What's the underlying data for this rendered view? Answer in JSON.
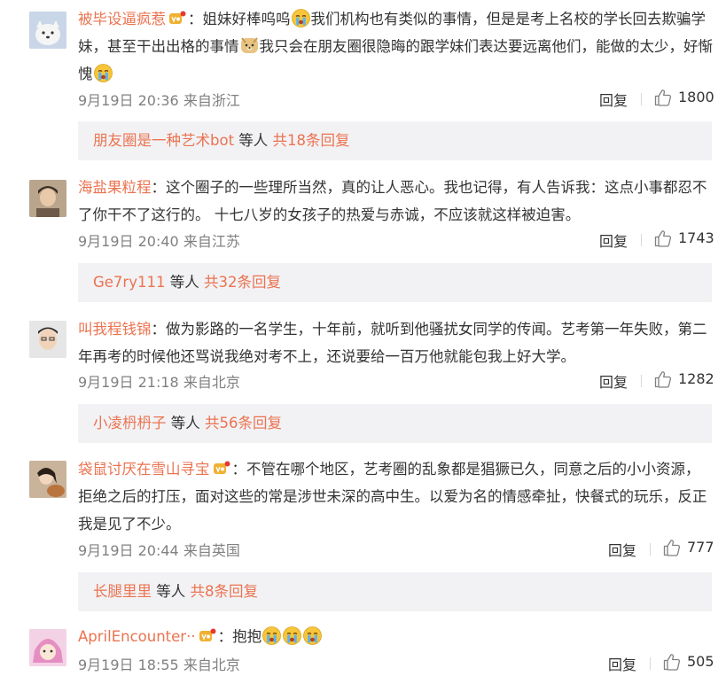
{
  "colors": {
    "accent": "#eb7350",
    "text": "#333333",
    "meta": "#808080",
    "subbox_bg": "#f2f2f5"
  },
  "comments": [
    {
      "user": "被毕设逼疯惹",
      "text_parts": [
        "：姐妹好棒呜呜",
        "我们机构也有类似的事情，但是是考上名校的学长回去欺骗学妹，甚至干出出格的事情",
        "我只会在朋友圈很隐晦的跟学妹们表达要远离他们，能做的太少，好惭愧"
      ],
      "icons": [
        "vip-icon",
        "cry-emoji-icon",
        "doge-emoji-icon",
        "cry-emoji-icon"
      ],
      "time": "9月19日 20:36 来自浙江",
      "reply_label": "回复",
      "likes": "1800",
      "sub_user": "朋友圈是一种艺术bot",
      "sub_mid": " 等人 ",
      "sub_more": "共18条回复"
    },
    {
      "user": "海盐果粒程",
      "text_parts": [
        "：这个圈子的一些理所当然，真的让人恶心。我也记得，有人告诉我：这点小事都忍不了你干不了这行的。 十七八岁的女孩子的热爱与赤诚，不应该就这样被迫害。"
      ],
      "icons": [],
      "time": "9月19日 20:40 来自江苏",
      "reply_label": "回复",
      "likes": "1743",
      "sub_user": "Ge7ry111",
      "sub_mid": " 等人 ",
      "sub_more": "共32条回复"
    },
    {
      "user": "叫我程钱锦",
      "text_parts": [
        "：做为影路的一名学生，十年前，就听到他骚扰女同学的传闻。艺考第一年失败，第二年再考的时候他还骂说我绝对考不上，还说要给一百万他就能包我上好大学。"
      ],
      "icons": [],
      "time": "9月19日 21:18 来自北京",
      "reply_label": "回复",
      "likes": "1282",
      "sub_user": "小凌枬枬子",
      "sub_mid": " 等人 ",
      "sub_more": "共56条回复"
    },
    {
      "user": "袋鼠讨厌在雪山寻宝",
      "text_parts": [
        "：不管在哪个地区，艺考圈的乱象都是猖獗已久，同意之后的小小资源，拒绝之后的打压，面对这些的常是涉世未深的高中生。以爱为名的情感牵扯，快餐式的玩乐，反正我是见了不少。"
      ],
      "icons": [
        "vip-icon"
      ],
      "time": "9月19日 20:44 来自英国",
      "reply_label": "回复",
      "likes": "777",
      "sub_user": "长腿里里",
      "sub_mid": " 等人 ",
      "sub_more": "共8条回复"
    },
    {
      "user": "AprilEncounter··",
      "text_parts": [
        "：抱抱"
      ],
      "icons": [
        "vip-icon",
        "cry-emoji-icon",
        "cry-emoji-icon",
        "cry-emoji-icon"
      ],
      "time": "9月19日 18:55 来自北京",
      "reply_label": "回复",
      "likes": "505"
    }
  ]
}
